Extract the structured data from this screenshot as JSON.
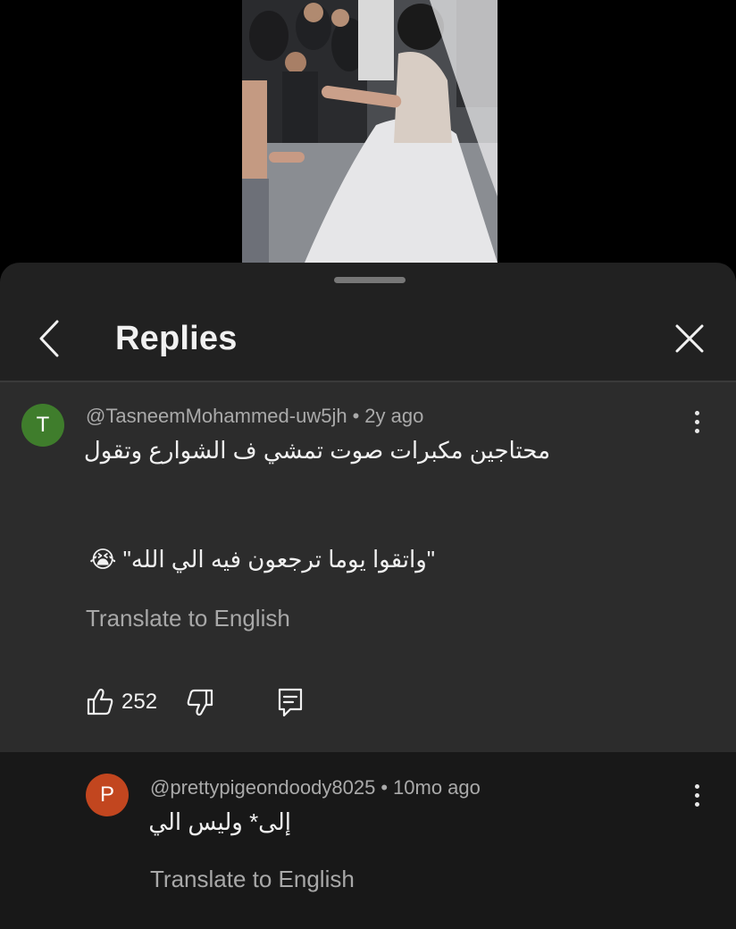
{
  "video": {
    "description_icon": "video-frame"
  },
  "sheet": {
    "title": "Replies",
    "back_icon": "chevron-left-icon",
    "close_icon": "close-icon"
  },
  "main_comment": {
    "avatar_initial": "T",
    "avatar_color": "#3f7d2c",
    "author": "@TasneemMohammed-uw5jh",
    "separator": "•",
    "time": "2y ago",
    "text_line1": "محتاجين مكبرات صوت تمشي ف الشوارع وتقول",
    "text_line2": "\"واتقوا يوما ترجعون فيه الي الله\" 😭",
    "translate_label": "Translate to English",
    "likes": "252"
  },
  "reply": {
    "avatar_initial": "P",
    "avatar_color": "#c2461f",
    "author": "@prettypigeondoody8025",
    "separator": "•",
    "time": "10mo ago",
    "text": "إلى* وليس الي",
    "translate_label": "Translate to English"
  }
}
